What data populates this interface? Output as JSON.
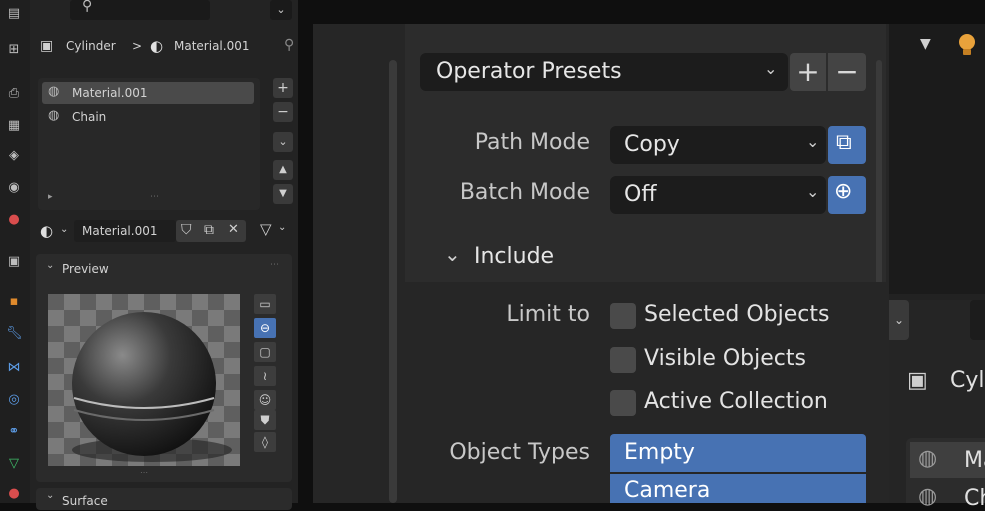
{
  "left_panel": {
    "breadcrumb": {
      "object": "Cylinder",
      "separator": ">",
      "material": "Material.001"
    },
    "material_slots": [
      "Material.001",
      "Chain"
    ],
    "material_selector": {
      "name": "Material.001"
    },
    "preview": {
      "header": "Preview"
    },
    "surface": {
      "header": "Surface"
    }
  },
  "dialog": {
    "operator_presets": {
      "label": "Operator Presets",
      "add": "+",
      "remove": "−"
    },
    "path_mode": {
      "label": "Path Mode",
      "value": "Copy"
    },
    "batch_mode": {
      "label": "Batch Mode",
      "value": "Off"
    },
    "include": {
      "header": "Include"
    },
    "limit_to": {
      "label": "Limit to",
      "options": [
        {
          "label": "Selected Objects",
          "checked": false
        },
        {
          "label": "Visible Objects",
          "checked": false
        },
        {
          "label": "Active Collection",
          "checked": false
        }
      ]
    },
    "object_types": {
      "label": "Object Types",
      "items": [
        "Empty",
        "Camera"
      ]
    }
  },
  "right_area": {
    "object_label": "Cyl",
    "material_label_1": "Ma",
    "material_label_2": "Ch"
  },
  "colors": {
    "accent": "#4772b3",
    "panel": "#232323",
    "dialog": "#2c2c2c"
  }
}
